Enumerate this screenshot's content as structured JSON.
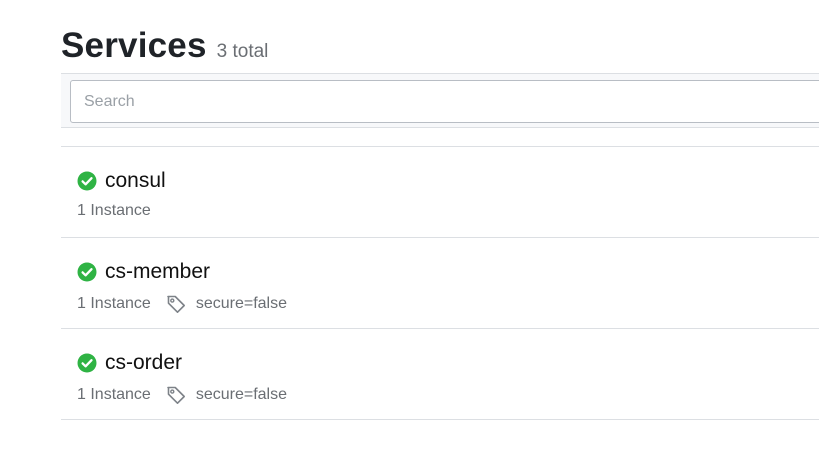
{
  "header": {
    "title": "Services",
    "count": "3 total"
  },
  "search": {
    "placeholder": "Search",
    "value": ""
  },
  "colors": {
    "status_passing": "#2fb344"
  },
  "services": [
    {
      "name": "consul",
      "status": "passing",
      "status_icon": "check-circle-icon",
      "instances": "1 Instance",
      "tags": []
    },
    {
      "name": "cs-member",
      "status": "passing",
      "status_icon": "check-circle-icon",
      "instances": "1 Instance",
      "tags": [
        "secure=false"
      ],
      "tag_icon": "tag-icon"
    },
    {
      "name": "cs-order",
      "status": "passing",
      "status_icon": "check-circle-icon",
      "instances": "1 Instance",
      "tags": [
        "secure=false"
      ],
      "tag_icon": "tag-icon"
    }
  ]
}
